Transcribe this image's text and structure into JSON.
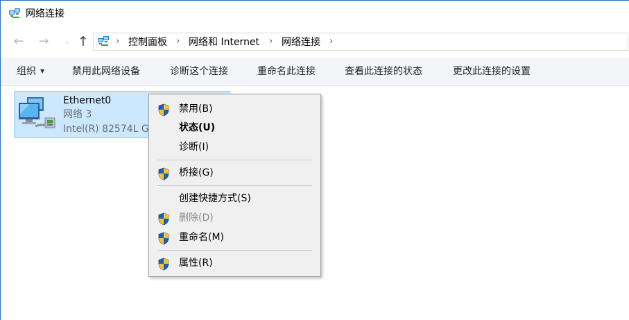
{
  "window": {
    "title": "网络连接"
  },
  "nav": {
    "back_glyph": "←",
    "forward_glyph": "→",
    "recent_glyph": "⌄",
    "up_glyph": "↑",
    "breadcrumbs": [
      "控制面板",
      "网络和 Internet",
      "网络连接"
    ],
    "separator": "›"
  },
  "toolbar": {
    "organize": "组织",
    "disable": "禁用此网络设备",
    "diagnose": "诊断这个连接",
    "rename": "重命名此连接",
    "view_status": "查看此连接的状态",
    "change_settings": "更改此连接的设置"
  },
  "connection": {
    "name": "Ethernet0",
    "network": "网络  3",
    "adapter": "Intel(R) 82574L Gigabit Network Connection"
  },
  "context_menu": {
    "items": [
      {
        "label": "禁用(B)",
        "icon": "uac-shield-icon"
      },
      {
        "label": "状态(U)"
      },
      {
        "label": "诊断(I)"
      },
      {
        "label": "桥接(G)",
        "icon": "uac-shield-icon"
      },
      {
        "label": "创建快捷方式(S)"
      },
      {
        "label": "删除(D)",
        "icon": "uac-shield-icon",
        "disabled": true
      },
      {
        "label": "重命名(M)",
        "icon": "uac-shield-icon"
      },
      {
        "label": "属性(R)",
        "icon": "uac-shield-icon"
      }
    ]
  },
  "colors": {
    "selection_fill": "#cce8ff",
    "selection_border": "#99d1ff",
    "command_bar": "#f3f5f8",
    "menu_background": "#f0f0f0",
    "window_border": "#2b6fb8"
  }
}
